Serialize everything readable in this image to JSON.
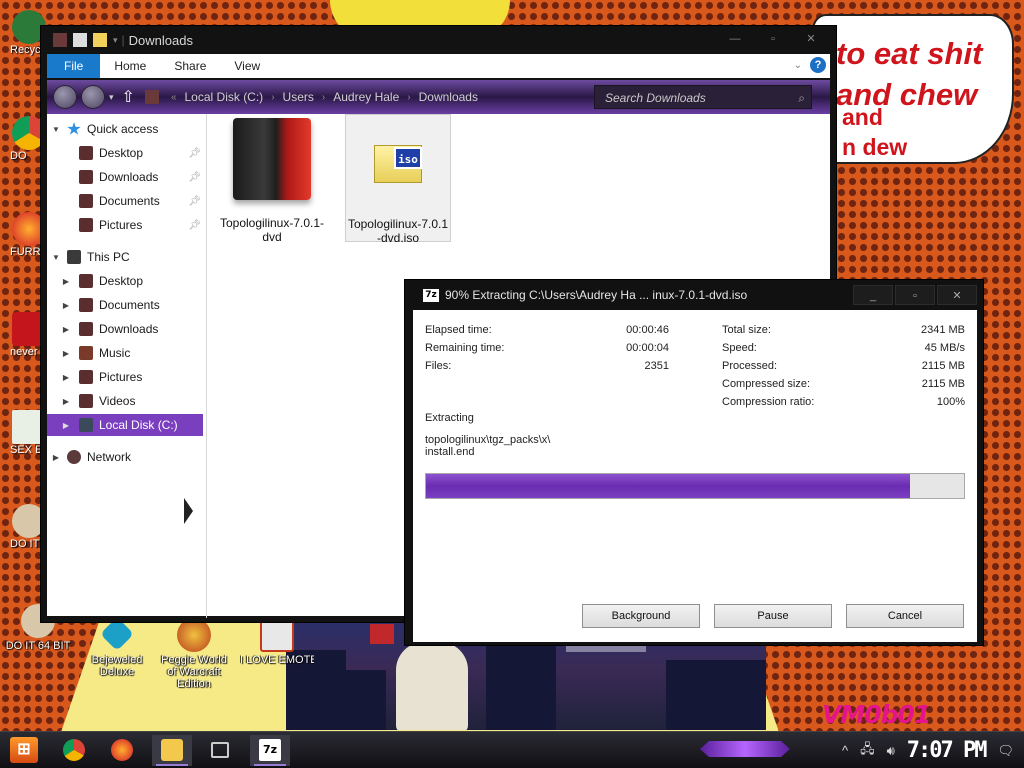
{
  "desktop": {
    "bubble_lines": [
      "to eat shit",
      "and chew",
      "and",
      "n dew"
    ],
    "watermark": "VM0b01",
    "left_icons": [
      "Recyc",
      "DO",
      "FURRY",
      "never why i",
      "SEX E",
      "DO IT"
    ],
    "bottom_icons": [
      "DO IT 64 BIT",
      "Bejeweled Deluxe",
      "Peggle World of Warcraft Edition",
      "I LOVE EMOTET"
    ]
  },
  "explorer": {
    "title": "Downloads",
    "ribbon_tabs": [
      "File",
      "Home",
      "Share",
      "View"
    ],
    "address_path": [
      "Local Disk (C:)",
      "Users",
      "Audrey Hale",
      "Downloads"
    ],
    "search_placeholder": "Search Downloads",
    "nav": {
      "quick_access": "Quick access",
      "quick_items": [
        "Desktop",
        "Downloads",
        "Documents",
        "Pictures"
      ],
      "this_pc": "This PC",
      "pc_items": [
        "Desktop",
        "Documents",
        "Downloads",
        "Music",
        "Pictures",
        "Videos",
        "Local Disk (C:)"
      ],
      "network": "Network"
    },
    "files": [
      {
        "name": "Topologilinux-7.0.1-dvd"
      },
      {
        "name": "Topologilinux-7.0.1-dvd.iso"
      }
    ]
  },
  "zip_dialog": {
    "title": "90% Extracting C:\\Users\\Audrey Ha ... inux-7.0.1-dvd.iso",
    "left_stats": [
      {
        "label": "Elapsed time:",
        "value": "00:00:46"
      },
      {
        "label": "Remaining time:",
        "value": "00:00:04"
      },
      {
        "label": "Files:",
        "value": "2351"
      }
    ],
    "right_stats": [
      {
        "label": "Total size:",
        "value": "2341 MB"
      },
      {
        "label": "Speed:",
        "value": "45 MB/s"
      },
      {
        "label": "Processed:",
        "value": "2115 MB"
      },
      {
        "label": "Compressed size:",
        "value": "2115 MB"
      },
      {
        "label": "Compression ratio:",
        "value": "100%"
      }
    ],
    "action_label": "Extracting",
    "path_line1": "topologilinux\\tgz_packs\\x\\",
    "path_line2": "install.end",
    "progress": 0.9,
    "buttons": {
      "background": "Background",
      "pause": "Pause",
      "cancel": "Cancel"
    }
  },
  "taskbar": {
    "clock": "7:07 PM",
    "apps": [
      "chrome",
      "firefox",
      "file-explorer",
      "task-view",
      "7-zip"
    ]
  },
  "colors": {
    "accent": "#7a3fbf",
    "file_tab": "#1979ca",
    "progress_fill": "#6a2cb0"
  }
}
